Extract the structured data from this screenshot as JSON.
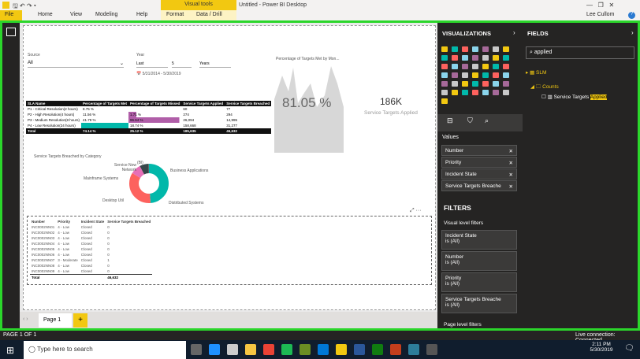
{
  "window": {
    "title": "Untitled - Power BI Desktop",
    "contextual_tab": "Visual tools",
    "user": "Lee Cullom"
  },
  "ribbon": {
    "tabs": [
      "File",
      "Home",
      "View",
      "Modeling",
      "Help",
      "Format",
      "Data / Drill"
    ]
  },
  "slicers": {
    "source_label": "Source",
    "source_value": "All",
    "year_label": "Year",
    "year_mode": "Last",
    "year_num": "5",
    "year_unit": "Years",
    "date_range": "5/31/2014 - 5/30/2019"
  },
  "area_chart": {
    "title": "Percentage of Targets Met by Mon..."
  },
  "card1": {
    "value": "81.05 %"
  },
  "card2": {
    "value": "186K",
    "label": "Service Targets Applied"
  },
  "sla_table": {
    "headers": [
      "SLA Name",
      "Percentage of Targets Met",
      "Percentage of Targets Missed",
      "Service Targets Applied",
      "Service Targets Breached"
    ],
    "rows": [
      [
        "P1 - Critical Resolution(2 hours)",
        "8.75 %",
        "",
        "60",
        "77"
      ],
      [
        "P2 - High Resolution(4 hours)",
        "11.56 %",
        "1.71 %",
        "274",
        "294"
      ],
      [
        "P3 - Medium Resolution(8 hours)",
        "41.79 %",
        "96.64 %",
        "26,094",
        "14,995"
      ],
      [
        "P4 - Low Resolution(24 hours)",
        "",
        "18.74 %",
        "158,668",
        "31,277"
      ]
    ],
    "total": [
      "Total",
      "74.14 %",
      "25.12 %",
      "185,635",
      "46,632"
    ]
  },
  "donut": {
    "title": "Service Targets Breached by Category",
    "labels": [
      "Service Now Network",
      "Mainframe Systems",
      "Desktop Util",
      "Business Applications",
      "Distributed Systems",
      "(Bl)"
    ]
  },
  "incident_table": {
    "headers": [
      "Number",
      "Priority",
      "Incident State",
      "Service Targets Breached"
    ],
    "rows": [
      [
        "INC0002NN01",
        "4 - Low",
        "Closed",
        "0"
      ],
      [
        "INC0002NN02",
        "4 - Low",
        "Closed",
        "0"
      ],
      [
        "INC0002NN03",
        "4 - Low",
        "Closed",
        "0"
      ],
      [
        "INC0002NN04",
        "4 - Low",
        "Closed",
        "0"
      ],
      [
        "INC0002NN05",
        "4 - Low",
        "Closed",
        "0"
      ],
      [
        "INC0002NN06",
        "4 - Low",
        "Closed",
        "0"
      ],
      [
        "INC0002NN07",
        "3 - Moderate",
        "Closed",
        "1"
      ],
      [
        "INC0002NN08",
        "4 - Low",
        "Closed",
        "0"
      ],
      [
        "INC0002NN09",
        "4 - Low",
        "Closed",
        "0"
      ]
    ],
    "total": [
      "Total",
      "",
      "",
      "46,632"
    ]
  },
  "pages": {
    "tab": "Page 1"
  },
  "visualizations": {
    "title": "VISUALIZATIONS",
    "values_label": "Values",
    "wells": [
      "Number",
      "Priority",
      "Incident State",
      "Service Targets Breache"
    ]
  },
  "filters": {
    "title": "FILTERS",
    "visual_level": "Visual level filters",
    "items": [
      {
        "name": "Incident State",
        "val": "is (All)"
      },
      {
        "name": "Number",
        "val": "is (All)"
      },
      {
        "name": "Priority",
        "val": "is (All)"
      },
      {
        "name": "Service Targets Breache",
        "val": "is (All)"
      }
    ],
    "page_level": "Page level filters"
  },
  "fields": {
    "title": "FIELDS",
    "search": "applied",
    "table": "SLM",
    "folder": "Counts",
    "field_prefix": "Service Targets ",
    "field_highlight": "Applied"
  },
  "status": {
    "page": "PAGE 1 OF 1",
    "connection": "Live connection: Connected"
  },
  "taskbar": {
    "search_placeholder": "Type here to search",
    "time": "2:11 PM",
    "date": "5/30/2019"
  },
  "colors": {
    "accent": "#f2c811",
    "teal": "#01b8aa",
    "pink": "#fd625e",
    "navy": "#374649",
    "green_border": "#2bd62b"
  }
}
